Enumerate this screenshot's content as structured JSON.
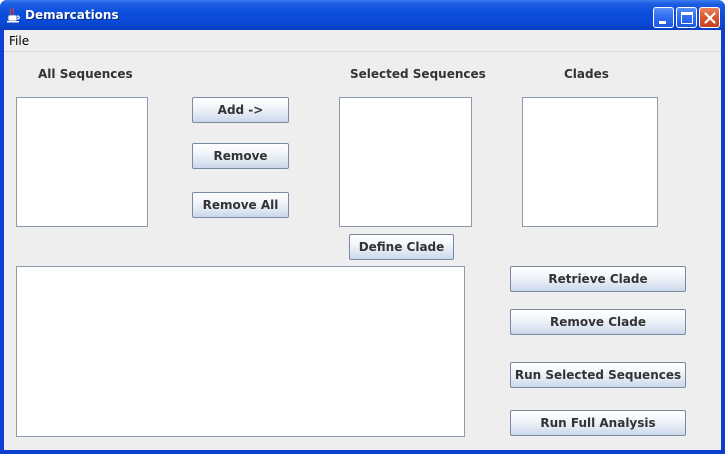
{
  "window": {
    "title": "Demarcations"
  },
  "menu": {
    "file_label": "File"
  },
  "panels": {
    "all_sequences_label": "All Sequences",
    "selected_sequences_label": "Selected Sequences",
    "clades_label": "Clades"
  },
  "buttons": {
    "add": "Add ->",
    "remove": "Remove",
    "remove_all": "Remove All",
    "define_clade": "Define Clade",
    "retrieve_clade": "Retrieve Clade",
    "remove_clade": "Remove Clade",
    "run_selected": "Run Selected Sequences",
    "run_full": "Run Full Analysis"
  },
  "colors": {
    "titlebar": "#0a49d6",
    "client_bg": "#eeeeee",
    "close_button": "#d9562e"
  },
  "icons": {
    "app": "java-coffee-cup-icon",
    "minimize": "minimize-icon",
    "maximize": "maximize-icon",
    "close": "close-icon"
  }
}
